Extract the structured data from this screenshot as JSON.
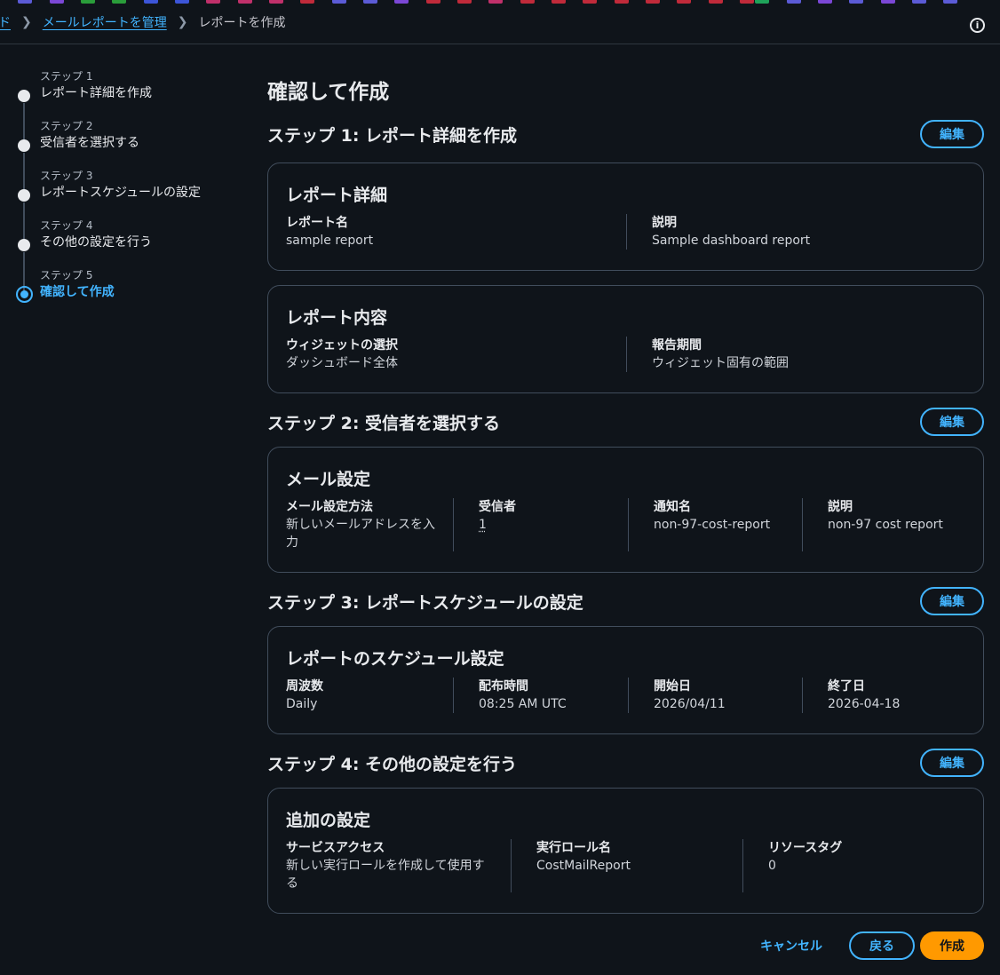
{
  "breadcrumb": {
    "items": [
      {
        "label": "ド",
        "link": true
      },
      {
        "label": "メールレポートを管理",
        "link": true
      },
      {
        "label": "レポートを作成",
        "link": false
      }
    ]
  },
  "steps_nav": [
    {
      "num": "ステップ 1",
      "label": "レポート詳細を作成",
      "active": false
    },
    {
      "num": "ステップ 2",
      "label": "受信者を選択する",
      "active": false
    },
    {
      "num": "ステップ 3",
      "label": "レポートスケジュールの設定",
      "active": false
    },
    {
      "num": "ステップ 4",
      "label": "その他の設定を行う",
      "active": false
    },
    {
      "num": "ステップ 5",
      "label": "確認して作成",
      "active": true
    }
  ],
  "main": {
    "title": "確認して作成",
    "edit_label": "編集",
    "step1": {
      "heading": "ステップ 1: レポート詳細を作成",
      "details": {
        "title": "レポート詳細",
        "name_key": "レポート名",
        "name_val": "sample report",
        "desc_key": "説明",
        "desc_val": "Sample dashboard report"
      },
      "content": {
        "title": "レポート内容",
        "widget_key": "ウィジェットの選択",
        "widget_val": "ダッシュボード全体",
        "period_key": "報告期間",
        "period_val": "ウィジェット固有の範囲"
      }
    },
    "step2": {
      "heading": "ステップ 2: 受信者を選択する",
      "email": {
        "title": "メール設定",
        "method_key": "メール設定方法",
        "method_val": "新しいメールアドレスを入力",
        "recipients_key": "受信者",
        "recipients_val": "1",
        "notif_key": "通知名",
        "notif_val": "non-97-cost-report",
        "desc_key": "説明",
        "desc_val": "non-97 cost report"
      }
    },
    "step3": {
      "heading": "ステップ 3: レポートスケジュールの設定",
      "schedule": {
        "title": "レポートのスケジュール設定",
        "freq_key": "周波数",
        "freq_val": "Daily",
        "time_key": "配布時間",
        "time_val": "08:25 AM UTC",
        "start_key": "開始日",
        "start_val": "2026/04/11",
        "end_key": "終了日",
        "end_val": "2026-04-18"
      }
    },
    "step4": {
      "heading": "ステップ 4: その他の設定を行う",
      "extra": {
        "title": "追加の設定",
        "access_key": "サービスアクセス",
        "access_val": "新しい実行ロールを作成して使用する",
        "role_key": "実行ロール名",
        "role_val": "CostMailReport",
        "tags_key": "リソースタグ",
        "tags_val": "0"
      }
    }
  },
  "footer": {
    "cancel": "キャンセル",
    "back": "戻る",
    "create": "作成"
  },
  "colors": {
    "accent": "#42b4ff",
    "primary": "#ff9900",
    "background": "#0f141a",
    "border": "#414d5c"
  }
}
